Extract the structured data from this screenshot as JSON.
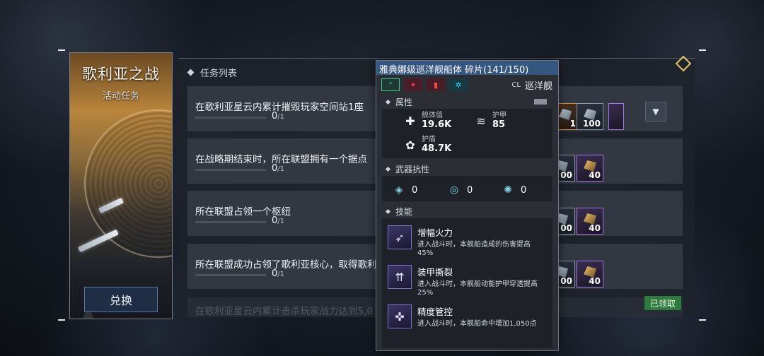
{
  "event": {
    "title": "歌利亚之战",
    "subtitle": "活动任务",
    "redeem_label": "兑换"
  },
  "tasks": {
    "header": "任务列表",
    "items": [
      {
        "text": "在歌利亚星云内累计摧毁玩家空间站1座",
        "progress": "0",
        "total": "/1"
      },
      {
        "text": "在战略期结束时，所在联盟拥有一个据点",
        "progress": "0",
        "total": "/1"
      },
      {
        "text": "所在联盟占领一个枢纽",
        "progress": "0",
        "total": "/1"
      },
      {
        "text": "所在联盟成功占领了歌利亚核心，取得歌利",
        "progress": "0",
        "total": "/1"
      },
      {
        "text": "在歌利亚星云内累计击杀玩家战力达到5,0"
      }
    ],
    "rewards": {
      "row1": [
        "1",
        "100"
      ],
      "row2": [
        "00",
        "40"
      ],
      "row3": [
        "00",
        "40"
      ],
      "row4": [
        "00",
        "40"
      ]
    },
    "claimed_label": "已领取"
  },
  "tooltip": {
    "title": "雅典娜级巡洋舰船体 碎片(141/150)",
    "class_prefix": "CL",
    "class_label": "巡洋舰",
    "attributes_header": "属性",
    "stats": {
      "hull_label": "舰体值",
      "hull_value": "19.6K",
      "armor_label": "护甲",
      "armor_value": "85",
      "shield_label": "护盾",
      "shield_value": "48.7K"
    },
    "resist_header": "武器抗性",
    "resists": [
      "0",
      "0",
      "0"
    ],
    "skills_header": "技能",
    "skills": [
      {
        "name": "增幅火力",
        "desc": "进入战斗时，本舰船造成的伤害提高45%"
      },
      {
        "name": "装甲撕裂",
        "desc": "进入战斗时，本舰船动能护甲穿透提高25%"
      },
      {
        "name": "精度管控",
        "desc": "进入战斗时，本舰船命中增加1,050点"
      }
    ]
  },
  "colors": {
    "accent_blue": "#35567f",
    "claimed_green": "#2f7a3e",
    "rarity_purple": "#a477e0",
    "rarity_orange": "#d98a2b"
  }
}
